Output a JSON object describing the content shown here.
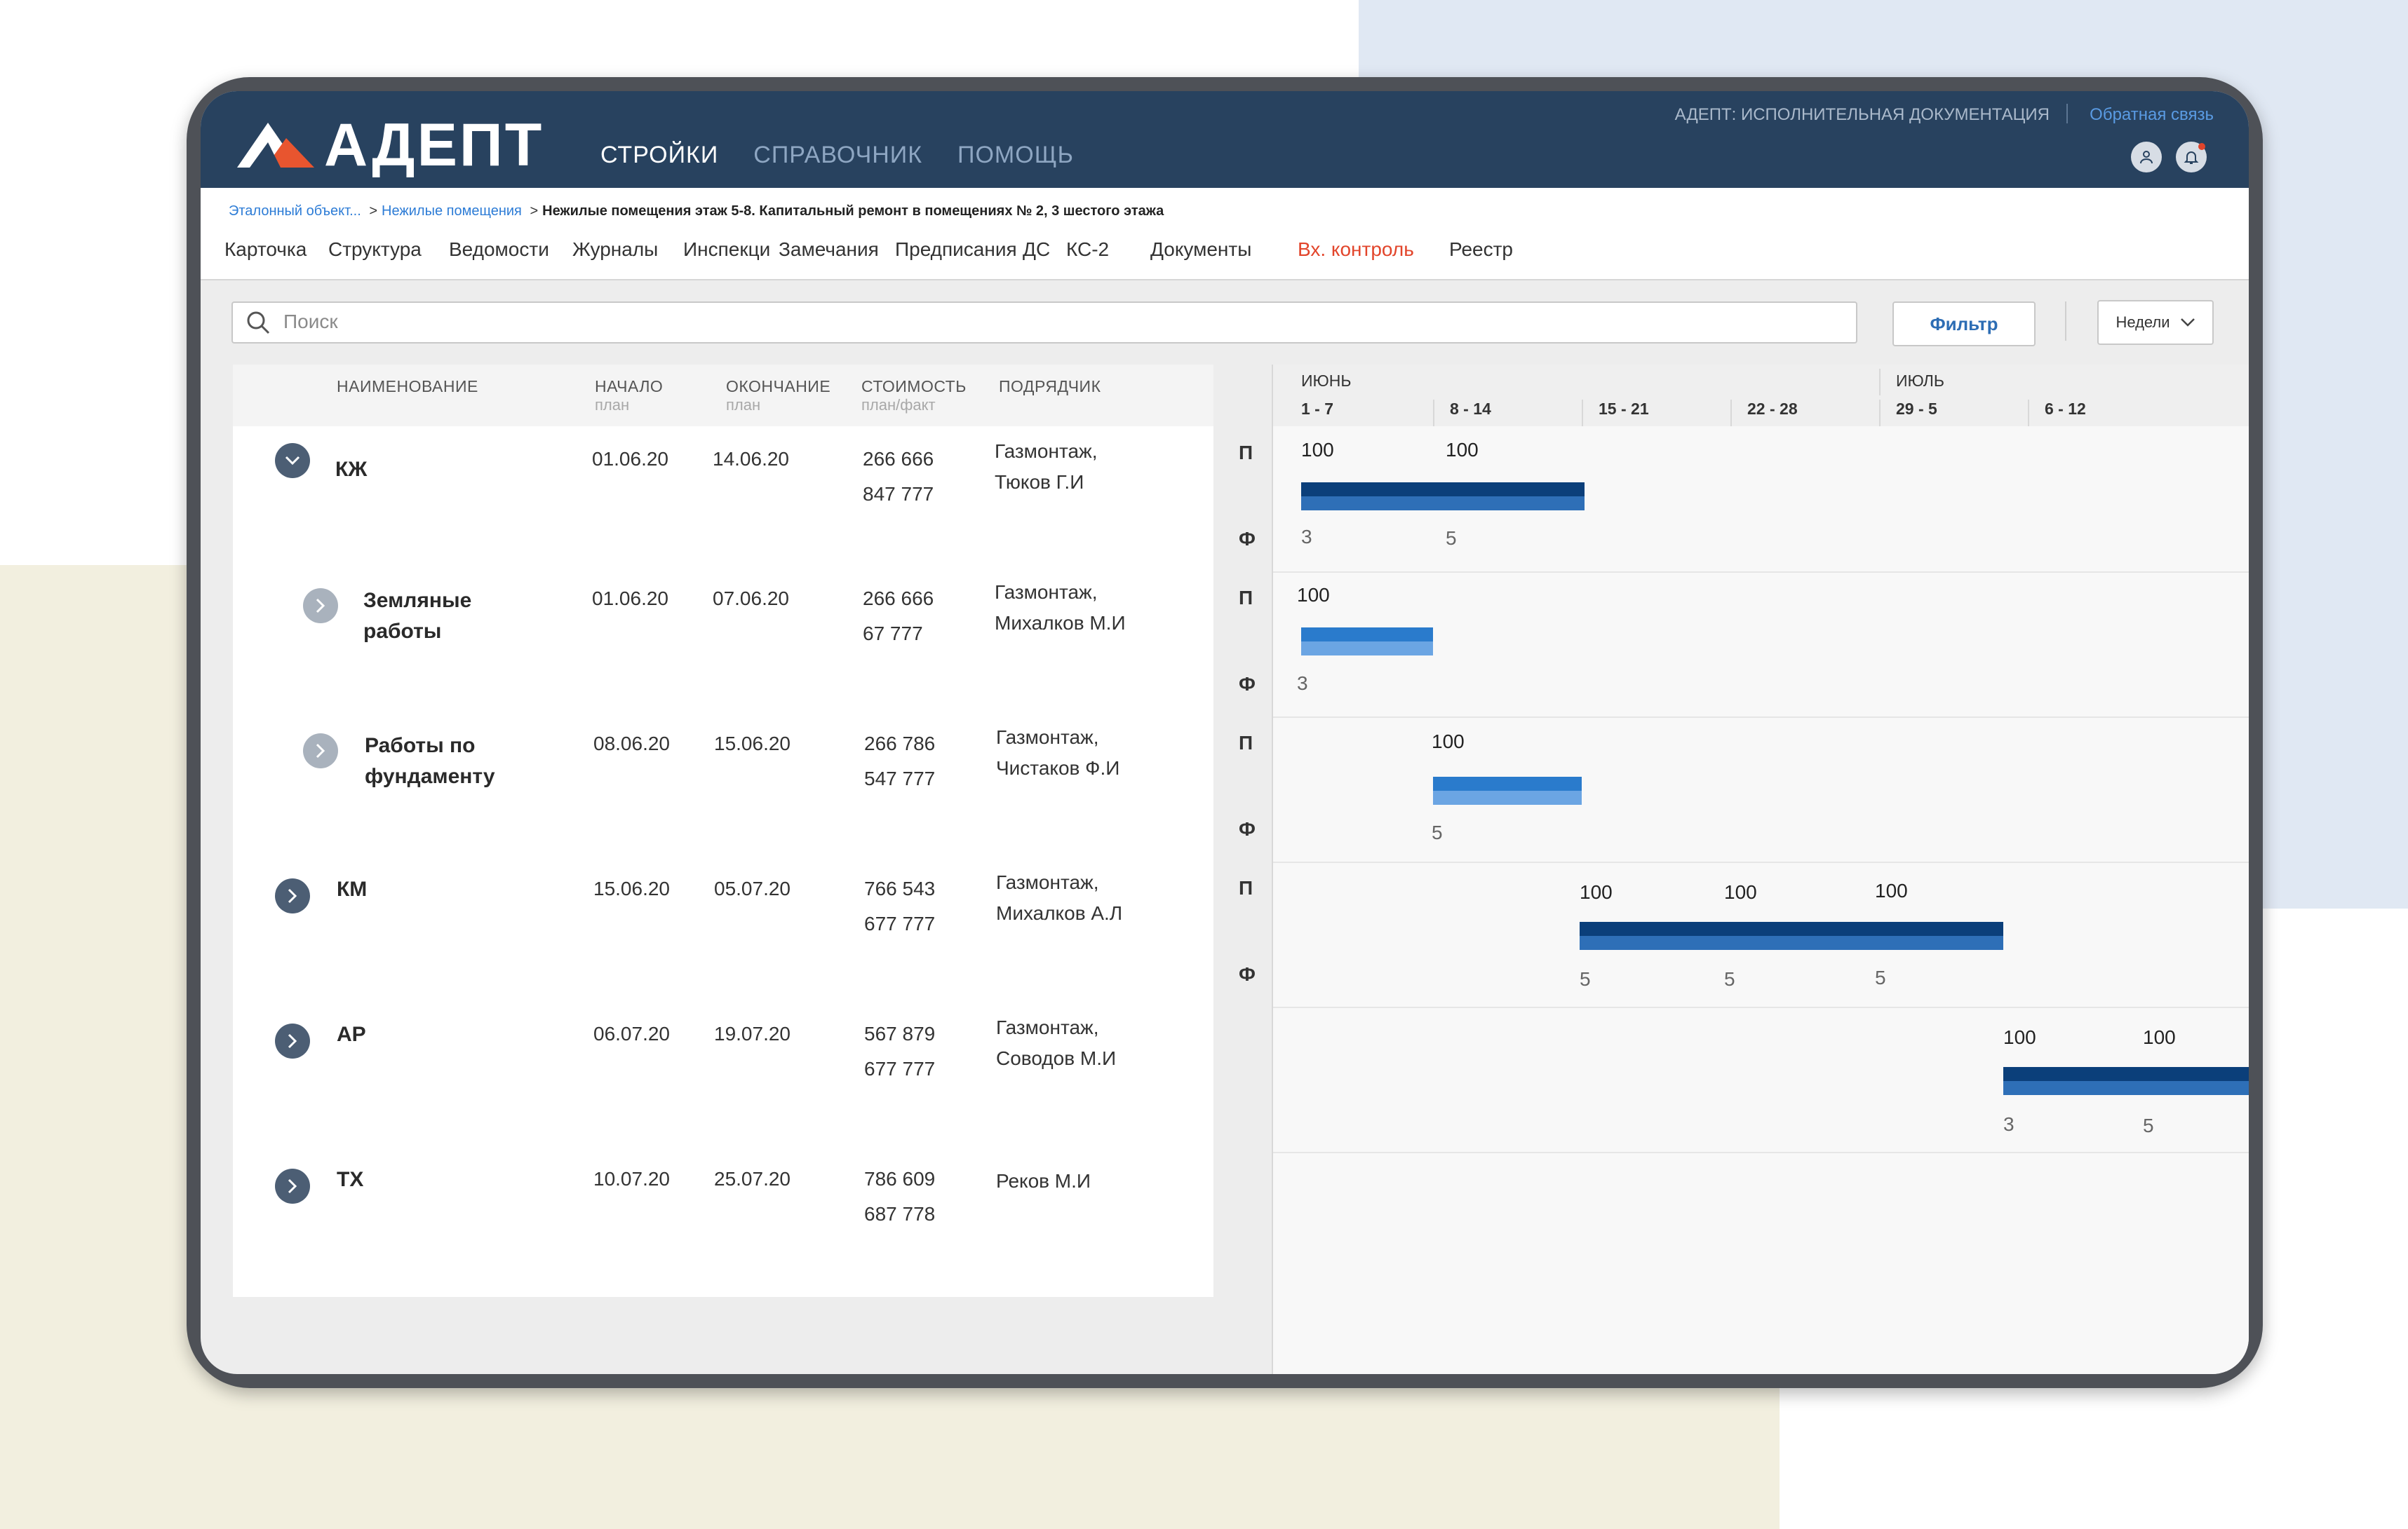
{
  "app": {
    "logo_text": "АДЕПТ",
    "nav": [
      "СТРОЙКИ",
      "СПРАВОЧНИК",
      "ПОМОЩЬ"
    ],
    "system_name": "АДЕПТ: ИСПОЛНИТЕЛЬНАЯ ДОКУМЕНТАЦИЯ",
    "feedback": "Обратная связь"
  },
  "breadcrumbs": {
    "items": [
      "Эталонный объект...",
      "Нежилые помещения"
    ],
    "current": "Нежилые помещения этаж 5-8. Капитальный ремонт в помещениях № 2, 3 шестого этажа",
    "sep": ">"
  },
  "tabs": [
    "Карточка",
    "Структура",
    "Ведомости",
    "Журналы",
    "Инспекци",
    "Замечания",
    "Предписания",
    "ДС",
    "КС-2",
    "Документы",
    "Вх. контроль",
    "Реестр"
  ],
  "toolbar": {
    "search_placeholder": "Поиск",
    "filter_label": "Фильтр",
    "period_label": "Недели"
  },
  "table": {
    "headers": {
      "name": "НАИМЕНОВАНИЕ",
      "start": "НАЧАЛО",
      "start_sub": "план",
      "end": "ОКОНЧАНИЕ",
      "end_sub": "план",
      "cost": "СТОИМОСТЬ",
      "cost_sub": "план/факт",
      "contractor": "ПОДРЯДЧИК"
    },
    "rows": [
      {
        "name_1": "КЖ",
        "name_2": "",
        "start": "01.06.20",
        "end": "14.06.20",
        "cost_plan": "266 666",
        "cost_fact": "847 777",
        "contractor_1": "Газмонтаж,",
        "contractor_2": "Тюков Г.И"
      },
      {
        "name_1": "Земляные",
        "name_2": "работы",
        "start": "01.06.20",
        "end": "07.06.20",
        "cost_plan": "266 666",
        "cost_fact": "67 777",
        "contractor_1": "Газмонтаж,",
        "contractor_2": "Михалков М.И"
      },
      {
        "name_1": "Работы по",
        "name_2": "фундаменту",
        "start": "08.06.20",
        "end": "15.06.20",
        "cost_plan": "266 786",
        "cost_fact": "547 777",
        "contractor_1": "Газмонтаж,",
        "contractor_2": "Чистаков Ф.И"
      },
      {
        "name_1": "КМ",
        "name_2": "",
        "start": "15.06.20",
        "end": "05.07.20",
        "cost_plan": "766 543",
        "cost_fact": "677 777",
        "contractor_1": "Газмонтаж,",
        "contractor_2": "Михалков А.Л"
      },
      {
        "name_1": "АР",
        "name_2": "",
        "start": "06.07.20",
        "end": "19.07.20",
        "cost_plan": "567 879",
        "cost_fact": "677 777",
        "contractor_1": "Газмонтаж,",
        "contractor_2": "Соводов М.И"
      },
      {
        "name_1": "ТХ",
        "name_2": "",
        "start": "10.07.20",
        "end": "25.07.20",
        "cost_plan": "786 609",
        "cost_fact": "687 778",
        "contractor_1": "Реков М.И",
        "contractor_2": ""
      }
    ]
  },
  "pf_labels": {
    "plan": "П",
    "fact": "Ф"
  },
  "gantt": {
    "months": [
      "ИЮНЬ",
      "ИЮЛЬ"
    ],
    "weeks": [
      "1 - 7",
      "8 - 14",
      "15 - 21",
      "22 - 28",
      "29 - 5",
      "6 - 12"
    ],
    "rows": [
      {
        "plan": [
          "100",
          "100"
        ],
        "fact": [
          "3",
          "5"
        ]
      },
      {
        "plan": [
          "100"
        ],
        "fact": [
          "3"
        ]
      },
      {
        "plan": [
          "100"
        ],
        "fact": [
          "5"
        ]
      },
      {
        "plan": [
          "100",
          "100",
          "100"
        ],
        "fact": [
          "5",
          "5",
          "5"
        ]
      },
      {
        "plan": [
          "100",
          "100"
        ],
        "fact": [
          "3",
          "5"
        ]
      }
    ]
  }
}
